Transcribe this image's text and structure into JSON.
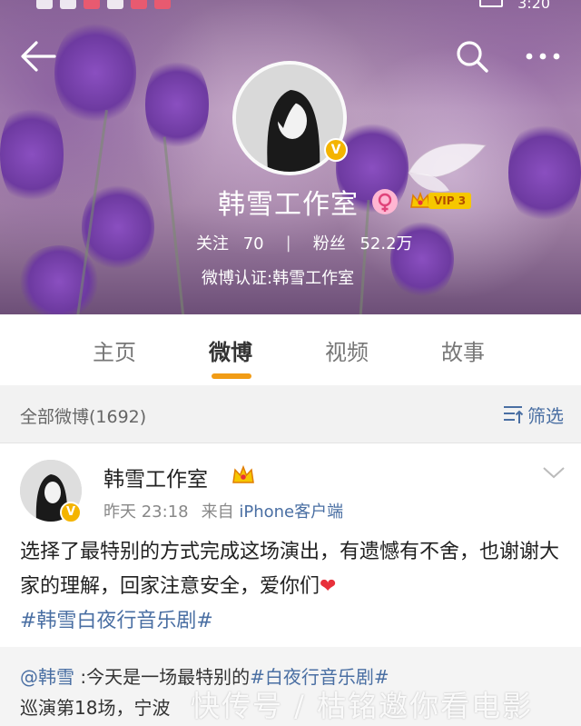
{
  "status_bar": {
    "time": "3:20"
  },
  "header": {
    "profile_name": "韩雪工作室",
    "vip_label": "VIP 3",
    "verified_badge": "V",
    "following_label": "关注",
    "following_count": "70",
    "stat_separator": "|",
    "followers_label": "粉丝",
    "followers_count": "52.2万",
    "verification": "微博认证:韩雪工作室"
  },
  "tabs": [
    {
      "label": "主页"
    },
    {
      "label": "微博"
    },
    {
      "label": "视频"
    },
    {
      "label": "故事"
    }
  ],
  "active_tab": "微博",
  "filter": {
    "title": "全部微博(1692)",
    "button": "筛选"
  },
  "post": {
    "author": "韩雪工作室",
    "time": "昨天 23:18",
    "from_prefix": "来自",
    "source": "iPhone客户端",
    "text": "选择了最特别的方式完成这场演出，有遗憾有不舍，也谢谢大家的理解，回家注意安全，爱你们",
    "heart": "❤",
    "hashtag": "#韩雪白夜行音乐剧#"
  },
  "repost": {
    "mention": "@韩雪",
    "text_part1": " :今天是一场最特别的",
    "hashtag": "#白夜行音乐剧#",
    "text_part2": "巡演第18场，宁波"
  },
  "watermark": "快传号 / 枯铭邀你看电影",
  "colors": {
    "accent_orange": "#f19c16",
    "link_blue": "#4a6fa3",
    "verified_gold": "#f4b400"
  }
}
